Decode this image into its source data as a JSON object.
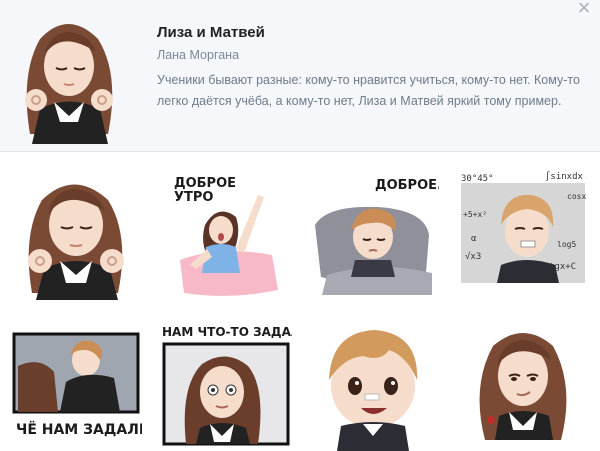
{
  "pack": {
    "title": "Лиза и Матвей",
    "author": "Лана Моргана",
    "description": "Ученики бывают разные: кому-то нравится учиться, кому-то нет. Кому-то легко даётся учёба, а кому-то нет, Лиза и Матвей яркий тому пример.",
    "close_icon": "×"
  },
  "stickers": [
    {
      "id": "ok-gesture",
      "caption": "",
      "icon": "girl-ok-gesture"
    },
    {
      "id": "good-morning",
      "caption_line1": "ДОБРОЕ",
      "caption_line2": "УТРО",
      "icon": "girl-waking-up"
    },
    {
      "id": "good-morning-boy",
      "caption": "ДОБРОЕ...",
      "icon": "boy-in-bed"
    },
    {
      "id": "math",
      "caption": "",
      "icon": "boy-with-formulas",
      "formulas": [
        "30°45°",
        "∫sinxdx",
        "cosx",
        "+5+x²",
        "√x3",
        "α",
        "tgx+C",
        "log5"
      ]
    },
    {
      "id": "what-homework",
      "caption": "ЧЁ НАМ ЗАДАЛИ?",
      "icon": "boy-and-girl"
    },
    {
      "id": "homework-question",
      "caption": "НАМ ЧТО-ТО ЗАДАЛИ?",
      "icon": "girl-scared"
    },
    {
      "id": "boy-smile",
      "caption": "",
      "icon": "boy-smiling"
    },
    {
      "id": "girl-smirk",
      "caption": "",
      "icon": "girl-smirking"
    }
  ],
  "colors": {
    "header_bg": "#f5f7fa",
    "hair_girl": "#7a4a35",
    "hair_boy": "#c98d55",
    "skin": "#f6dccb"
  }
}
